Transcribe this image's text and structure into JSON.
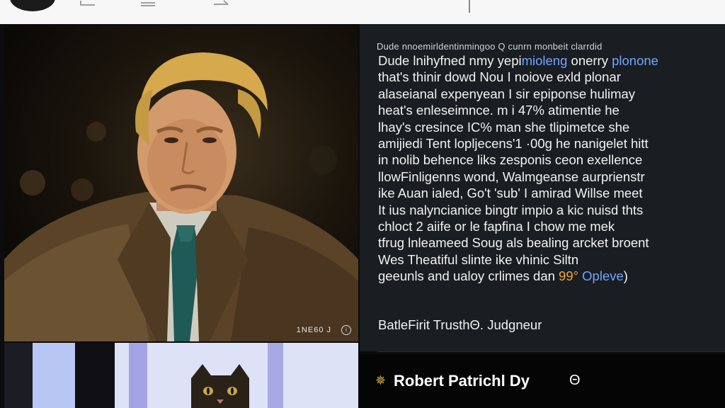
{
  "post": {
    "header": "Dude nnoemirldentinmingoo Q cunrn monbeit clarrdid",
    "lines": [
      {
        "parts": [
          {
            "t": "Dude lnihyfned nmy yepi"
          },
          {
            "t": "mioleng",
            "c": "blue"
          },
          {
            "t": " onerry "
          },
          {
            "t": "plonone",
            "c": "blue"
          }
        ]
      },
      {
        "parts": [
          {
            "t": "that's thinir dowd Nou  I noiove exld  plonar"
          }
        ]
      },
      {
        "parts": [
          {
            "t": "alaseianal expenyean I sir epiponse  hulimay"
          }
        ]
      },
      {
        "parts": [
          {
            "t": "heat's enleseimnce. m i 47% atimentie  he"
          }
        ]
      },
      {
        "parts": [
          {
            "t": "lhay's cresince IC% man she tlipimetce she"
          }
        ]
      },
      {
        "parts": [
          {
            "t": "amijiedi Tent lopljecens'1 ·00g he nanigelet hitt"
          }
        ]
      },
      {
        "parts": [
          {
            "t": "in nolib behence liks zesponis  ceon  exellence"
          }
        ]
      },
      {
        "parts": [
          {
            "t": "llowFinligenns wond, Walmgeanse aurprienstr"
          }
        ]
      },
      {
        "parts": [
          {
            "t": "ike Auan ialed, Go't 'sub' I amirad Willse meet"
          }
        ]
      },
      {
        "parts": [
          {
            "t": "It ius nalyncianice bingtr impio a kic nuisd thts"
          }
        ]
      },
      {
        "parts": [
          {
            "t": "chloct 2 aiife or le fapfina I chow me mek"
          }
        ]
      },
      {
        "parts": [
          {
            "t": "tfrug lnleameed Soug als bealing arcket broent"
          }
        ]
      },
      {
        "parts": [
          {
            "t": "Wes  Theatiful slinte ike vhinic Siltn"
          }
        ]
      },
      {
        "parts": [
          {
            "t": "geeunls and ualoy crlimes dan  "
          },
          {
            "t": "99°",
            "c": "orange"
          },
          {
            "t": " Opleve",
            "c": "blue"
          },
          {
            "t": ")"
          }
        ]
      }
    ],
    "byline": "BatleFirit TrusthΘ. Judgneur",
    "author": "Robert Patrichl Dy",
    "verified_icon": "Θ",
    "photo_counter": "1NE60 J"
  },
  "icons": {
    "toolbar": [
      "back-icon",
      "menu-icon",
      "share-icon"
    ],
    "author": "star-icon",
    "photo": "info-icon"
  },
  "colors": {
    "panel_bg": "#1a1d22",
    "link_blue": "#6fa6ff",
    "accent_orange": "#f2a63a",
    "star_gold": "#e0b552"
  }
}
